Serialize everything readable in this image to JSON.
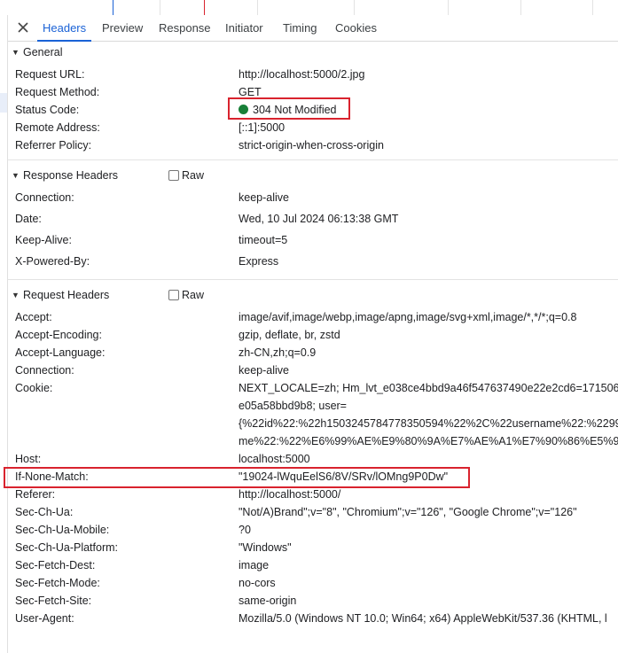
{
  "tabs": [
    {
      "label": "Headers",
      "active": true
    },
    {
      "label": "Preview"
    },
    {
      "label": "Response"
    },
    {
      "label": "Initiator"
    },
    {
      "label": "Timing"
    },
    {
      "label": "Cookies"
    }
  ],
  "general": {
    "title": "General",
    "rows": [
      {
        "key": "Request URL:",
        "value": "http://localhost:5000/2.jpg"
      },
      {
        "key": "Request Method:",
        "value": "GET"
      },
      {
        "key": "Status Code:",
        "value": "304 Not Modified"
      },
      {
        "key": "Remote Address:",
        "value": "[::1]:5000"
      },
      {
        "key": "Referrer Policy:",
        "value": "strict-origin-when-cross-origin"
      }
    ]
  },
  "response_headers": {
    "title": "Response Headers",
    "raw_label": "Raw",
    "rows": [
      {
        "key": "Connection:",
        "value": "keep-alive"
      },
      {
        "key": "Date:",
        "value": "Wed, 10 Jul 2024 06:13:38 GMT"
      },
      {
        "key": "Keep-Alive:",
        "value": "timeout=5"
      },
      {
        "key": "X-Powered-By:",
        "value": "Express"
      }
    ]
  },
  "request_headers": {
    "title": "Request Headers",
    "raw_label": "Raw",
    "rows": [
      {
        "key": "Accept:",
        "value": "image/avif,image/webp,image/apng,image/svg+xml,image/*,*/*;q=0.8"
      },
      {
        "key": "Accept-Encoding:",
        "value": "gzip, deflate, br, zstd"
      },
      {
        "key": "Accept-Language:",
        "value": "zh-CN,zh;q=0.9"
      },
      {
        "key": "Connection:",
        "value": "keep-alive"
      },
      {
        "key": "Cookie:",
        "value": "NEXT_LOCALE=zh; Hm_lvt_e038ce4bbd9a46f547637490e22e2cd6=171506",
        "continuation": [
          "e05a58bbd9b8; user=",
          "{%22id%22:%22h1503245784778350594%22%2C%22username%22:%2299",
          "me%22:%22%E6%99%AE%E9%80%9A%E7%AE%A1%E7%90%86%E5%91%"
        ]
      },
      {
        "key": "Host:",
        "value": "localhost:5000"
      },
      {
        "key": "If-None-Match:",
        "value": "\"19024-lWquEelS6/8V/SRv/lOMng9P0Dw\""
      },
      {
        "key": "Referer:",
        "value": "http://localhost:5000/"
      },
      {
        "key": "Sec-Ch-Ua:",
        "value": "\"Not/A)Brand\";v=\"8\", \"Chromium\";v=\"126\", \"Google Chrome\";v=\"126\""
      },
      {
        "key": "Sec-Ch-Ua-Mobile:",
        "value": "?0"
      },
      {
        "key": "Sec-Ch-Ua-Platform:",
        "value": "\"Windows\""
      },
      {
        "key": "Sec-Fetch-Dest:",
        "value": "image"
      },
      {
        "key": "Sec-Fetch-Mode:",
        "value": "no-cors"
      },
      {
        "key": "Sec-Fetch-Site:",
        "value": "same-origin"
      },
      {
        "key": "User-Agent:",
        "value": "Mozilla/5.0 (Windows NT 10.0; Win64; x64) AppleWebKit/537.36 (KHTML, l"
      }
    ]
  },
  "colors": {
    "accent": "#1a62d6",
    "status_ok": "#188038",
    "highlight": "#d9232e"
  }
}
